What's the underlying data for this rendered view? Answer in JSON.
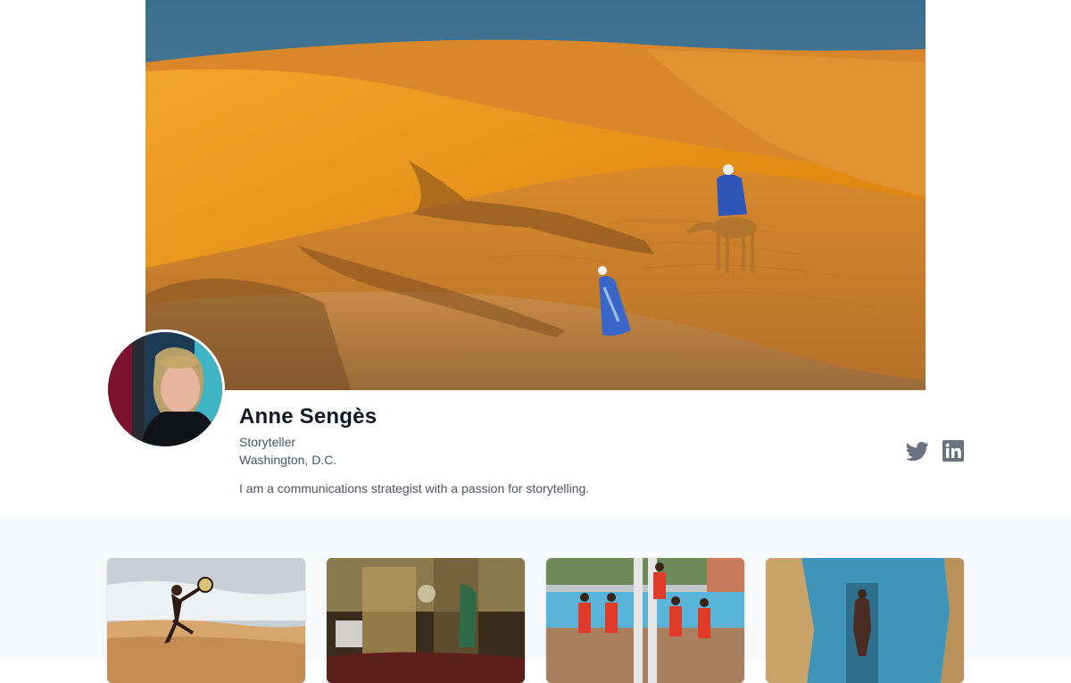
{
  "profile": {
    "name": "Anne Sengès",
    "title": "Storyteller",
    "location": "Washington, D.C.",
    "bio": "I am a communications strategist with a passion for storytelling."
  },
  "social": {
    "twitter_icon": "twitter-icon",
    "linkedin_icon": "linkedin-icon",
    "icon_color": "#6b7280"
  },
  "gallery": {
    "item_count": 4
  },
  "colors": {
    "page_bg": "#ffffff",
    "gallery_bg": "#f8f9fb",
    "name_text": "#111827",
    "meta_text": "#4b5563"
  }
}
